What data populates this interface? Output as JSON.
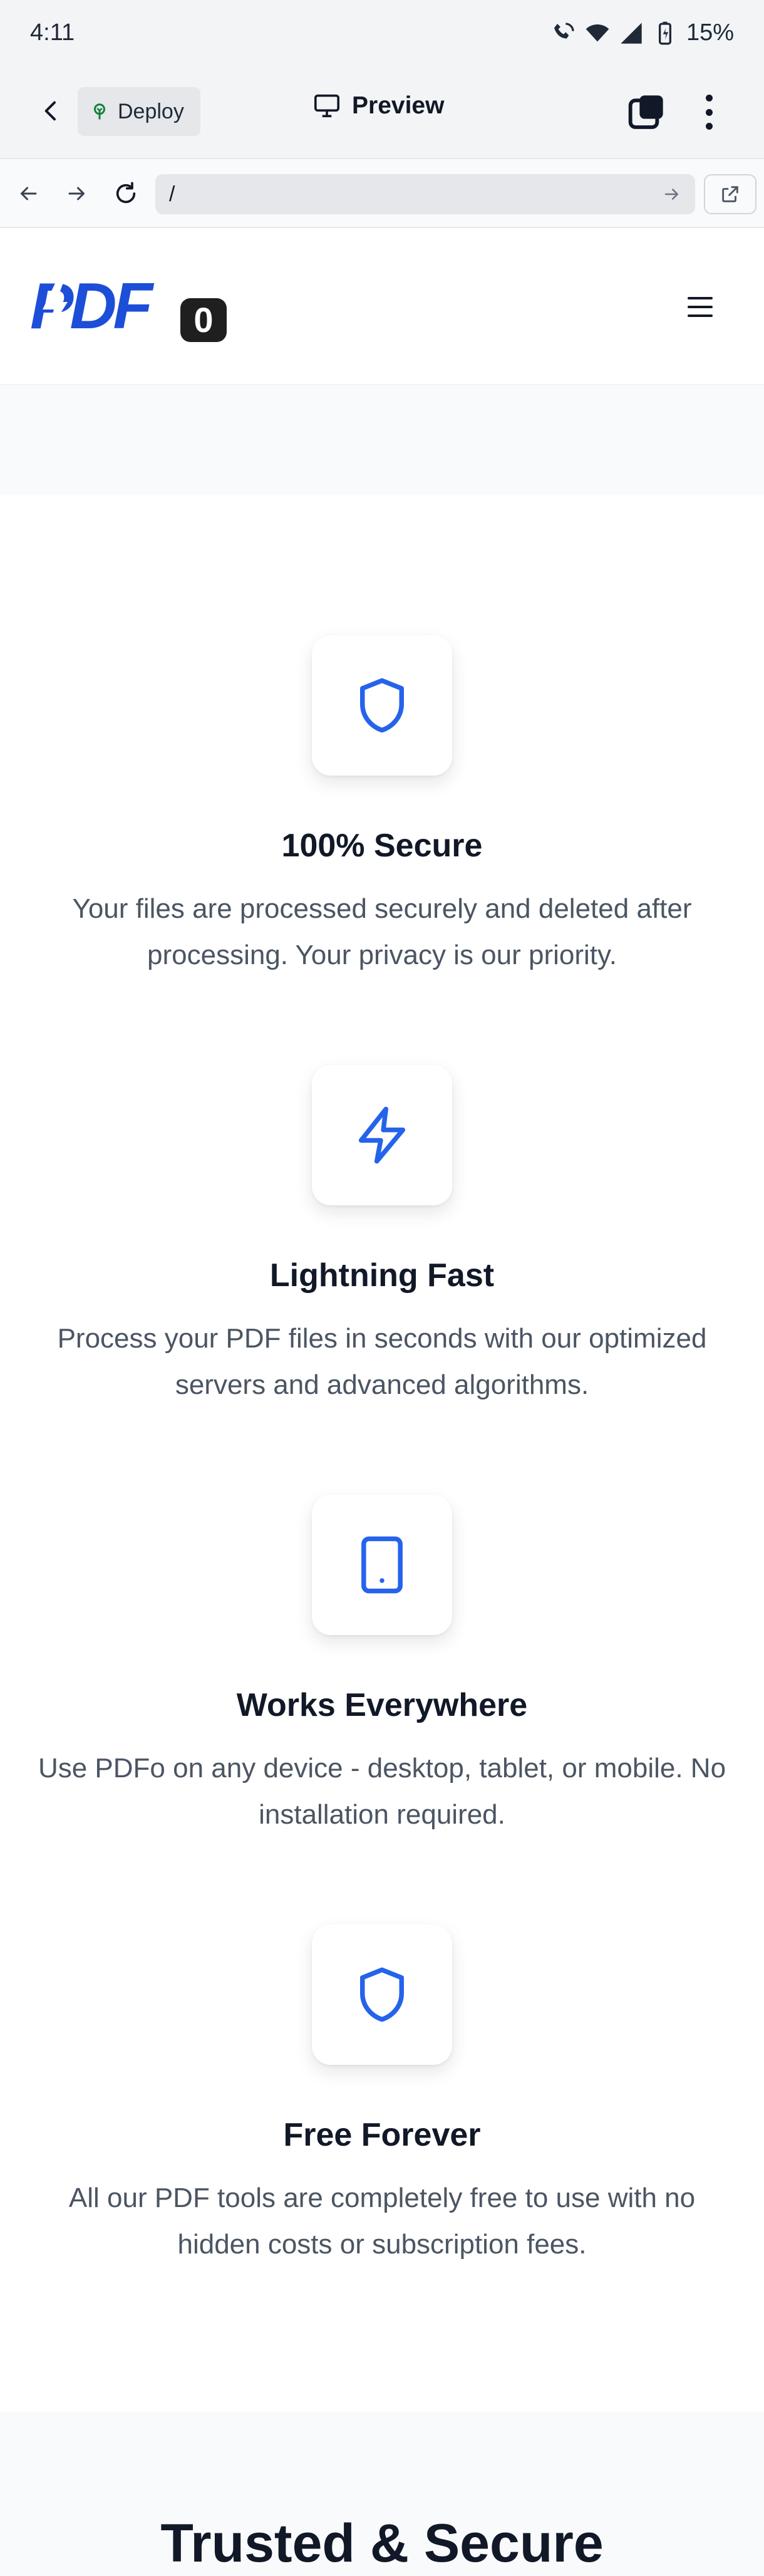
{
  "status_bar": {
    "time": "4:11",
    "battery": "15%"
  },
  "app_bar": {
    "deploy_label": "Deploy",
    "preview_label": "Preview"
  },
  "url_bar": {
    "path": "/"
  },
  "site": {
    "logo_text": "PDFo"
  },
  "features": [
    {
      "icon": "shield-icon",
      "title": "100% Secure",
      "description": "Your files are processed securely and deleted after processing. Your privacy is our priority."
    },
    {
      "icon": "lightning-icon",
      "title": "Lightning Fast",
      "description": "Process your PDF files in seconds with our optimized servers and advanced algorithms."
    },
    {
      "icon": "tablet-icon",
      "title": "Works Everywhere",
      "description": "Use PDFo on any device - desktop, tablet, or mobile. No installation required."
    },
    {
      "icon": "shield-icon",
      "title": "Free Forever",
      "description": "All our PDF tools are completely free to use with no hidden costs or subscription fees."
    }
  ],
  "next_section": {
    "title": "Trusted & Secure"
  },
  "colors": {
    "accent": "#2563eb",
    "logo_blue": "#1d4ed8",
    "text": "#111827",
    "muted": "#4b5563"
  }
}
